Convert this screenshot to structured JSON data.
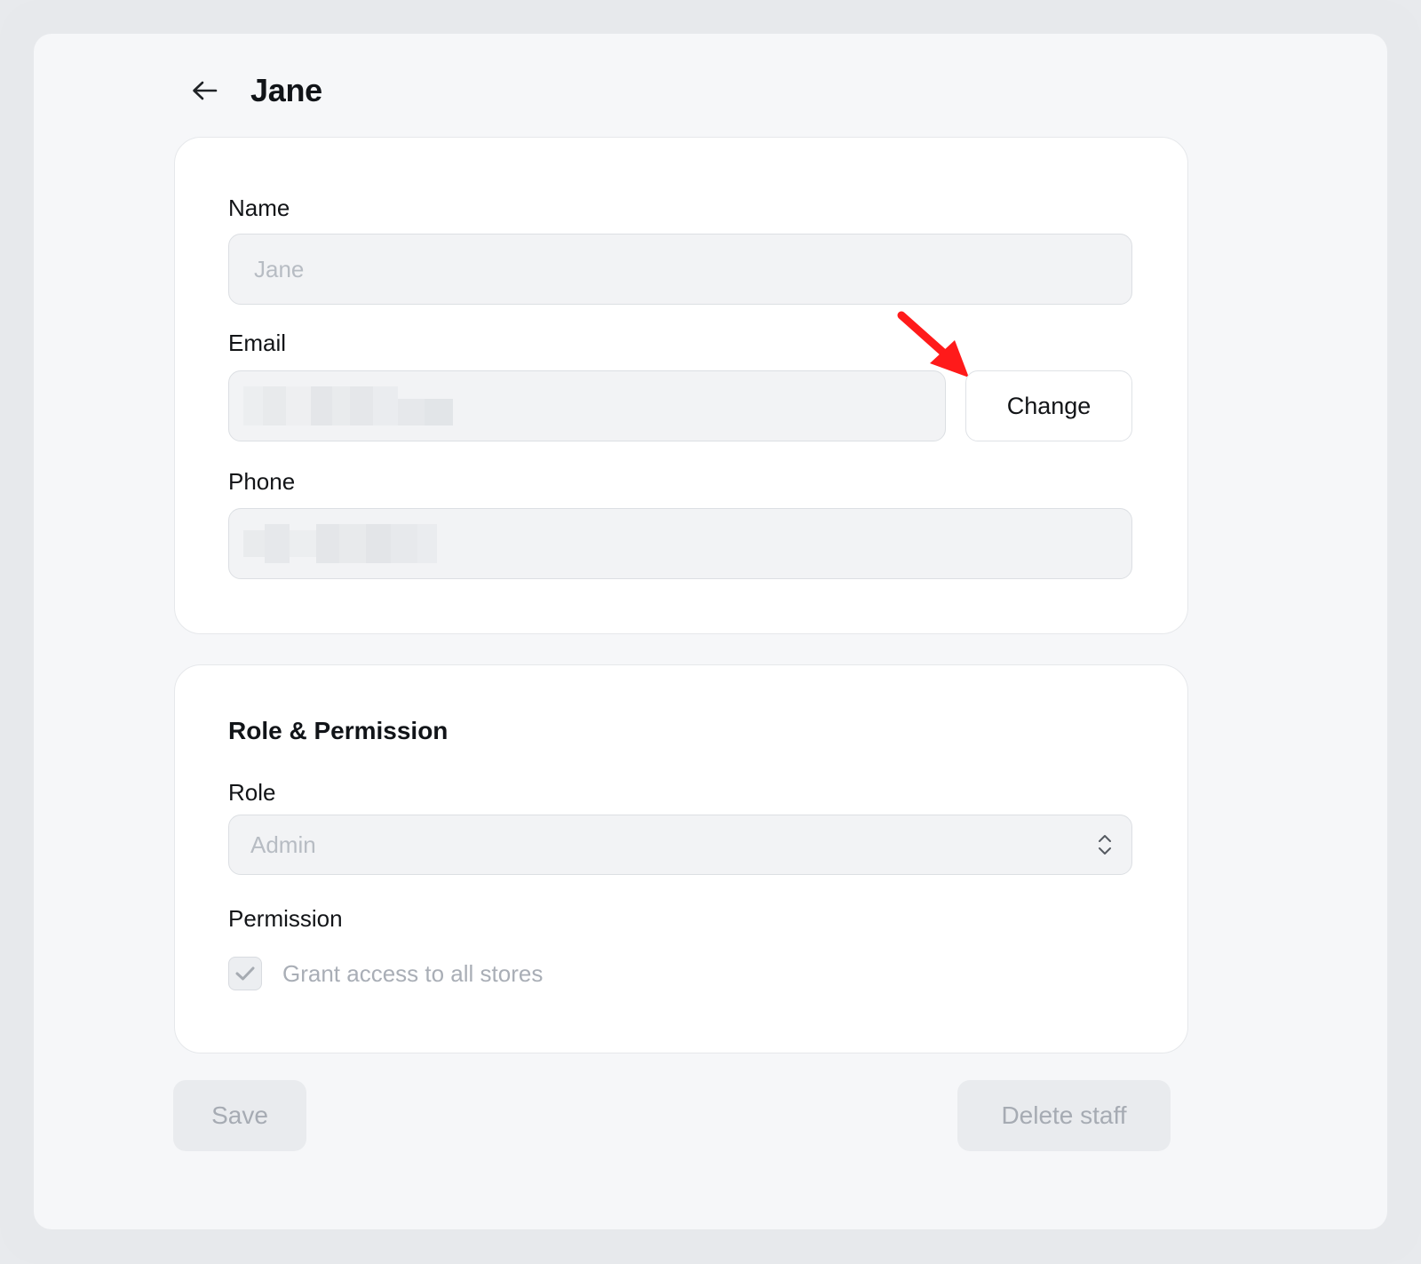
{
  "header": {
    "back_icon": "arrow-left-icon",
    "title": "Jane"
  },
  "profile": {
    "name_label": "Name",
    "name_placeholder": "Jane",
    "email_label": "Email",
    "email_value": "",
    "change_label": "Change",
    "phone_label": "Phone",
    "phone_value": ""
  },
  "annotation": {
    "arrow_color": "#ff1a1a"
  },
  "role_section": {
    "title": "Role & Permission",
    "role_label": "Role",
    "role_selected": "Admin",
    "permission_label": "Permission",
    "grant_all_label": "Grant access to all stores",
    "grant_all_checked": true
  },
  "actions": {
    "save_label": "Save",
    "delete_label": "Delete staff"
  }
}
